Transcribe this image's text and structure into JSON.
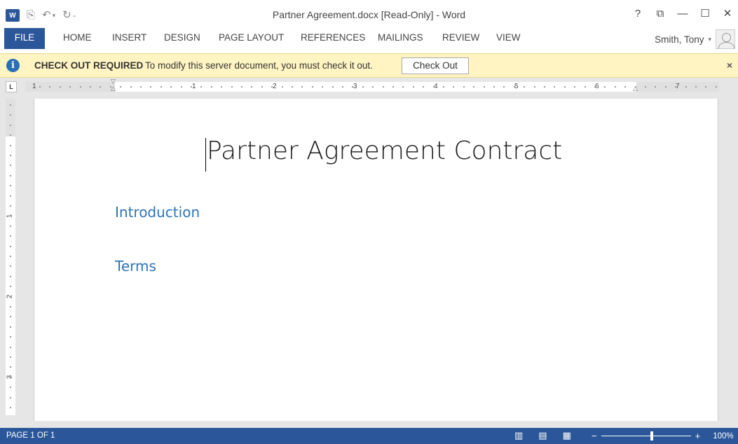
{
  "window": {
    "title": "Partner Agreement.docx [Read-Only] - Word",
    "controls": [
      "?",
      "⧉",
      "—",
      "☐",
      "✕"
    ]
  },
  "qat": {
    "logo_text": "W",
    "save_icon": "save-icon",
    "undo_icon": "undo-icon",
    "redo_icon": "redo-icon",
    "customize_icon": "customize-qat-icon"
  },
  "ribbon": {
    "tabs": [
      "FILE",
      "HOME",
      "INSERT",
      "DESIGN",
      "PAGE LAYOUT",
      "REFERENCES",
      "MAILINGS",
      "REVIEW",
      "VIEW"
    ],
    "user_name": "Smith, Tony"
  },
  "message_bar": {
    "title": "CHECK OUT REQUIRED",
    "text": "To modify this server document, you must check it out.",
    "button_label": "Check Out",
    "close_label": "×"
  },
  "ruler": {
    "tab_selector": "L",
    "horizontal_numbers": [
      "1",
      "1",
      "2",
      "3",
      "4",
      "5",
      "6",
      "7"
    ],
    "vertical_numbers": [
      "1",
      "2",
      "3"
    ]
  },
  "document": {
    "title": "Partner Agreement Contract",
    "headings": [
      "Introduction",
      "Terms"
    ]
  },
  "status_bar": {
    "page_info": "PAGE 1 OF 1",
    "zoom_minus": "−",
    "zoom_plus": "+",
    "zoom_level": "100%"
  },
  "colors": {
    "accent": "#2b579a",
    "heading": "#2e74b5",
    "message_bar": "#fff4c2"
  }
}
